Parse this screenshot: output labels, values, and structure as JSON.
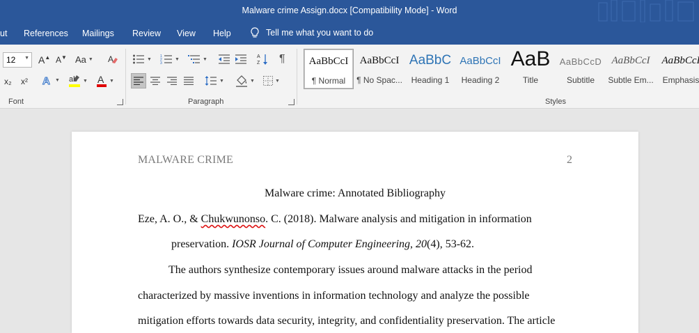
{
  "window": {
    "title": "Malware crime Assign.docx [Compatibility Mode]  -  Word"
  },
  "tabs": {
    "partial_layout": "ut",
    "references": "References",
    "mailings": "Mailings",
    "review": "Review",
    "view": "View",
    "help": "Help",
    "tell_me": "Tell me what you want to do"
  },
  "ribbon": {
    "font": {
      "size": "12",
      "change_case": "Aa",
      "group_label": "Font",
      "subscript": "x₂",
      "superscript": "x²"
    },
    "paragraph": {
      "group_label": "Paragraph"
    },
    "styles": {
      "group_label": "Styles",
      "items": [
        {
          "sample": "AaBbCcI",
          "name": "¶ Normal"
        },
        {
          "sample": "AaBbCcI",
          "name": "¶ No Spac..."
        },
        {
          "sample": "AaBbC",
          "name": "Heading 1"
        },
        {
          "sample": "AaBbCcI",
          "name": "Heading 2"
        },
        {
          "sample": "AaB",
          "name": "Title"
        },
        {
          "sample": "AaBbCcD",
          "name": "Subtitle"
        },
        {
          "sample": "AaBbCcI",
          "name": "Subtle Em..."
        },
        {
          "sample": "AaBbCcI",
          "name": "Emphasis"
        }
      ]
    },
    "colors": {
      "highlight": "#ffff00",
      "font_color": "#e00000"
    }
  },
  "document": {
    "running_head": "MALWARE CRIME",
    "page_number": "2",
    "heading": "Malware crime: Annotated Bibliography",
    "ref_line1_a": "Eze, A. O., & ",
    "ref_line1_misspelled": "Chukwunonso",
    "ref_line1_b": ". C. (2018). Malware analysis and mitigation in information",
    "ref_line2_a": "preservation. ",
    "ref_line2_journal": "IOSR Journal of Computer Engineering",
    "ref_line2_b": ", ",
    "ref_line2_volume": "20",
    "ref_line2_c": "(4), 53-62.",
    "body_line1": "The authors synthesize contemporary issues around malware attacks in the period",
    "body_line2": "characterized by massive inventions in information technology and analyze the possible",
    "body_line3": "mitigation efforts towards data security, integrity, and confidentiality preservation. The article"
  }
}
